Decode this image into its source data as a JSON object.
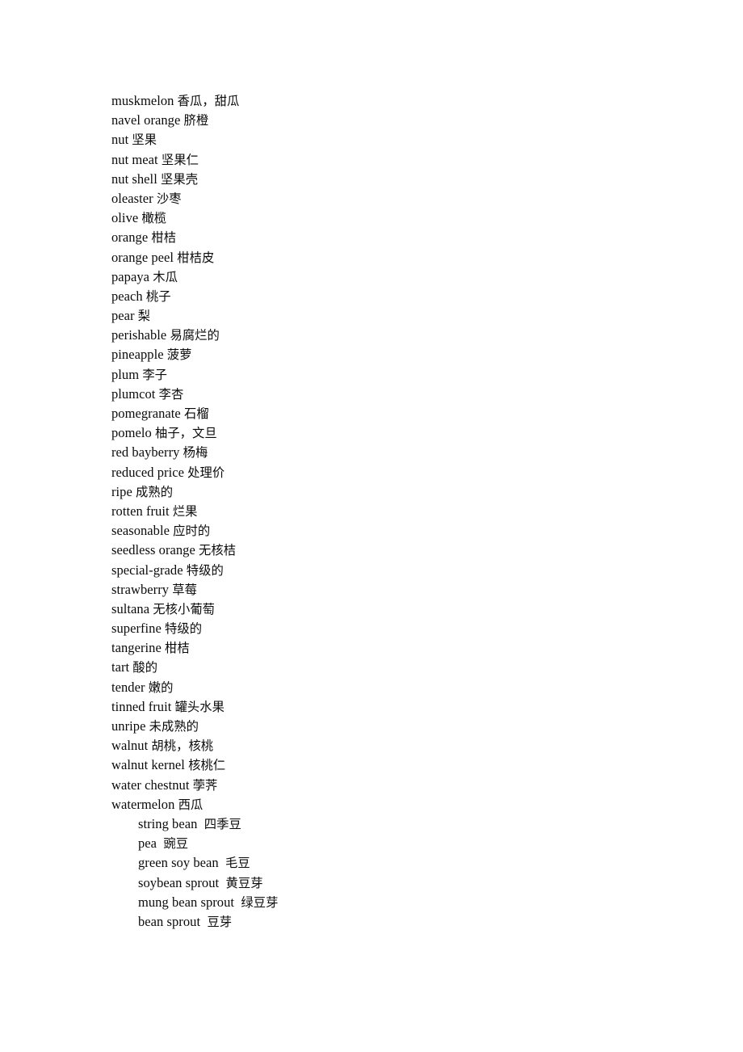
{
  "document": {
    "page_background": "#ffffff",
    "text_color": "#0b0b0b",
    "entries": [
      {
        "term": "muskmelon",
        "gloss": "香瓜，甜瓜",
        "indent": false
      },
      {
        "term": "navel orange",
        "gloss": "脐橙",
        "indent": false
      },
      {
        "term": "nut",
        "gloss": "坚果",
        "indent": false
      },
      {
        "term": "nut meat",
        "gloss": "坚果仁",
        "indent": false
      },
      {
        "term": "nut shell",
        "gloss": "坚果壳",
        "indent": false
      },
      {
        "term": "oleaster",
        "gloss": "沙枣",
        "indent": false
      },
      {
        "term": "olive",
        "gloss": "橄榄",
        "indent": false
      },
      {
        "term": "orange",
        "gloss": "柑桔",
        "indent": false
      },
      {
        "term": "orange peel",
        "gloss": "柑桔皮",
        "indent": false
      },
      {
        "term": "papaya",
        "gloss": "木瓜",
        "indent": false
      },
      {
        "term": "peach",
        "gloss": "桃子",
        "indent": false
      },
      {
        "term": "pear",
        "gloss": "梨",
        "indent": false
      },
      {
        "term": "perishable",
        "gloss": "易腐烂的",
        "indent": false
      },
      {
        "term": "pineapple",
        "gloss": "菠萝",
        "indent": false
      },
      {
        "term": "plum",
        "gloss": "李子",
        "indent": false
      },
      {
        "term": "plumcot",
        "gloss": "李杏",
        "indent": false
      },
      {
        "term": "pomegranate",
        "gloss": "石榴",
        "indent": false
      },
      {
        "term": "pomelo",
        "gloss": "柚子，文旦",
        "indent": false
      },
      {
        "term": "red bayberry",
        "gloss": "杨梅",
        "indent": false
      },
      {
        "term": "reduced price",
        "gloss": "处理价",
        "indent": false
      },
      {
        "term": "ripe",
        "gloss": "成熟的",
        "indent": false
      },
      {
        "term": "rotten fruit",
        "gloss": "烂果",
        "indent": false
      },
      {
        "term": "seasonable",
        "gloss": "应时的",
        "indent": false
      },
      {
        "term": "seedless orange",
        "gloss": "无核桔",
        "indent": false
      },
      {
        "term": "special-grade",
        "gloss": "特级的",
        "indent": false
      },
      {
        "term": "strawberry",
        "gloss": "草莓",
        "indent": false
      },
      {
        "term": "sultana",
        "gloss": "无核小葡萄",
        "indent": false
      },
      {
        "term": "superfine",
        "gloss": "特级的",
        "indent": false
      },
      {
        "term": "tangerine",
        "gloss": "柑桔",
        "indent": false
      },
      {
        "term": "tart",
        "gloss": "酸的",
        "indent": false
      },
      {
        "term": "tender",
        "gloss": "嫩的",
        "indent": false
      },
      {
        "term": "tinned fruit",
        "gloss": "罐头水果",
        "indent": false
      },
      {
        "term": "unripe",
        "gloss": "未成熟的",
        "indent": false
      },
      {
        "term": "walnut",
        "gloss": "胡桃，核桃",
        "indent": false
      },
      {
        "term": "walnut kernel",
        "gloss": "核桃仁",
        "indent": false
      },
      {
        "term": "water chestnut",
        "gloss": "荸荠",
        "indent": false
      },
      {
        "term": "watermelon",
        "gloss": "西瓜",
        "indent": false
      },
      {
        "term": "string bean",
        "gloss": "四季豆",
        "indent": true
      },
      {
        "term": "pea",
        "gloss": "豌豆",
        "indent": true
      },
      {
        "term": "green soy bean",
        "gloss": "毛豆",
        "indent": true
      },
      {
        "term": "soybean sprout",
        "gloss": "黄豆芽",
        "indent": true
      },
      {
        "term": "mung bean sprout",
        "gloss": "绿豆芽",
        "indent": true
      },
      {
        "term": "bean sprout",
        "gloss": "豆芽",
        "indent": true
      }
    ]
  }
}
